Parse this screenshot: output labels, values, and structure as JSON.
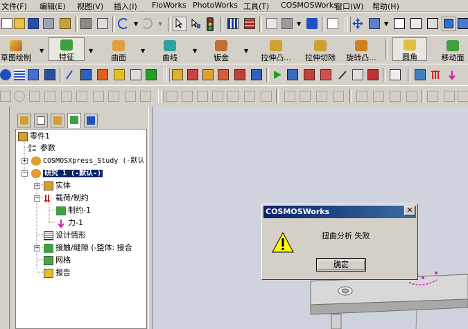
{
  "menubar": {
    "items": [
      "文件(F)",
      "编辑(E)",
      "视图(V)",
      "插入(I)",
      "FloWorks",
      "PhotoWorks",
      "工具(T)",
      "COSMOSWorks",
      "窗口(W)",
      "帮助(H)"
    ]
  },
  "features_toolbar": {
    "sketch": "草图绘制",
    "feature": "特征",
    "surface": "曲面",
    "curve": "曲线",
    "sheetmetal": "钣金",
    "extrude_boss": "拉伸凸...",
    "extrude_cut": "拉伸切除",
    "revolve_boss": "旋转凸...",
    "fillet": "圆角",
    "move_face": "移动面"
  },
  "tree": {
    "root": "零件1",
    "items": [
      {
        "label": "参数",
        "indent": 1
      },
      {
        "label": "COSMOSXpress_Study (-默认",
        "indent": 1
      },
      {
        "label": "研究 1 (-默认-)",
        "indent": 1
      },
      {
        "label": "实体",
        "indent": 2
      },
      {
        "label": "载荷/制约",
        "indent": 2
      },
      {
        "label": "制约-1",
        "indent": 3
      },
      {
        "label": "力-1",
        "indent": 3
      },
      {
        "label": "设计情形",
        "indent": 2
      },
      {
        "label": "接触/缝隙 (-整体: 接合",
        "indent": 2
      },
      {
        "label": "网格",
        "indent": 2
      },
      {
        "label": "报告",
        "indent": 2
      }
    ]
  },
  "dialog": {
    "title": "COSMOSWorks",
    "message": "扭曲分析 失败",
    "ok_label": "确定",
    "close_symbol": "✕"
  },
  "colors": {
    "title_bar": "#0a246a",
    "selection": "#0a246a",
    "viewport": "#cfd3dd"
  }
}
